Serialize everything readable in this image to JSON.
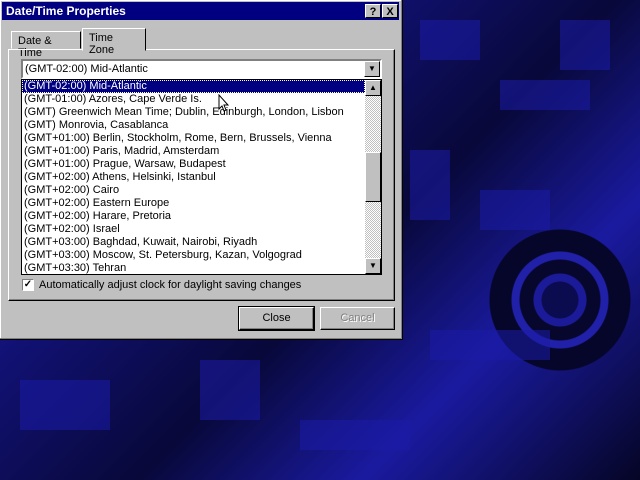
{
  "window": {
    "title": "Date/Time Properties",
    "help_button": "?",
    "close_button": "X"
  },
  "tabs": [
    {
      "label": "Date & Time",
      "active": false
    },
    {
      "label": "Time Zone",
      "active": true
    }
  ],
  "timezone": {
    "selected": "(GMT-02:00) Mid-Atlantic",
    "options": [
      "(GMT-02:00) Mid-Atlantic",
      "(GMT-01:00) Azores, Cape Verde Is.",
      "(GMT) Greenwich Mean Time; Dublin, Edinburgh, London, Lisbon",
      "(GMT) Monrovia, Casablanca",
      "(GMT+01:00) Berlin, Stockholm, Rome, Bern, Brussels, Vienna",
      "(GMT+01:00) Paris, Madrid, Amsterdam",
      "(GMT+01:00) Prague, Warsaw, Budapest",
      "(GMT+02:00) Athens, Helsinki, Istanbul",
      "(GMT+02:00) Cairo",
      "(GMT+02:00) Eastern Europe",
      "(GMT+02:00) Harare, Pretoria",
      "(GMT+02:00) Israel",
      "(GMT+03:00) Baghdad, Kuwait, Nairobi, Riyadh",
      "(GMT+03:00) Moscow, St. Petersburg, Kazan, Volgograd",
      "(GMT+03:30) Tehran"
    ],
    "highlighted_index": 0
  },
  "dst": {
    "label": "Automatically adjust clock for daylight saving changes",
    "checked": true
  },
  "buttons": {
    "close": "Close",
    "cancel": "Cancel"
  },
  "icons": {
    "combo_arrow": "triangle-down-icon",
    "scroll_up": "triangle-up-icon",
    "scroll_down": "triangle-down-icon",
    "cursor": "mouse-pointer-icon"
  },
  "colors": {
    "titlebar": "#000080",
    "selection": "#000080",
    "face": "#c0c0c0"
  }
}
